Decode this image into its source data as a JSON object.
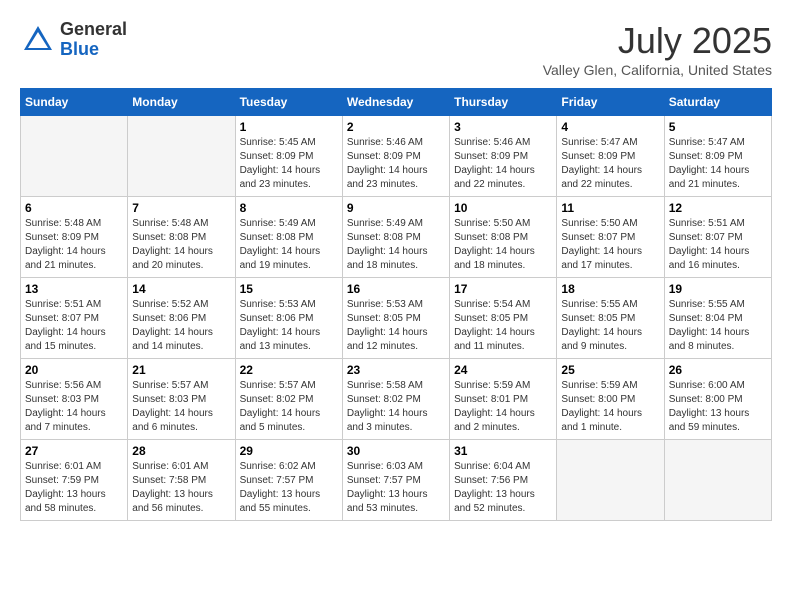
{
  "header": {
    "logo_general": "General",
    "logo_blue": "Blue",
    "month_year": "July 2025",
    "location": "Valley Glen, California, United States"
  },
  "days_of_week": [
    "Sunday",
    "Monday",
    "Tuesday",
    "Wednesday",
    "Thursday",
    "Friday",
    "Saturday"
  ],
  "weeks": [
    [
      {
        "day": "",
        "info": ""
      },
      {
        "day": "",
        "info": ""
      },
      {
        "day": "1",
        "info": "Sunrise: 5:45 AM\nSunset: 8:09 PM\nDaylight: 14 hours and 23 minutes."
      },
      {
        "day": "2",
        "info": "Sunrise: 5:46 AM\nSunset: 8:09 PM\nDaylight: 14 hours and 23 minutes."
      },
      {
        "day": "3",
        "info": "Sunrise: 5:46 AM\nSunset: 8:09 PM\nDaylight: 14 hours and 22 minutes."
      },
      {
        "day": "4",
        "info": "Sunrise: 5:47 AM\nSunset: 8:09 PM\nDaylight: 14 hours and 22 minutes."
      },
      {
        "day": "5",
        "info": "Sunrise: 5:47 AM\nSunset: 8:09 PM\nDaylight: 14 hours and 21 minutes."
      }
    ],
    [
      {
        "day": "6",
        "info": "Sunrise: 5:48 AM\nSunset: 8:09 PM\nDaylight: 14 hours and 21 minutes."
      },
      {
        "day": "7",
        "info": "Sunrise: 5:48 AM\nSunset: 8:08 PM\nDaylight: 14 hours and 20 minutes."
      },
      {
        "day": "8",
        "info": "Sunrise: 5:49 AM\nSunset: 8:08 PM\nDaylight: 14 hours and 19 minutes."
      },
      {
        "day": "9",
        "info": "Sunrise: 5:49 AM\nSunset: 8:08 PM\nDaylight: 14 hours and 18 minutes."
      },
      {
        "day": "10",
        "info": "Sunrise: 5:50 AM\nSunset: 8:08 PM\nDaylight: 14 hours and 18 minutes."
      },
      {
        "day": "11",
        "info": "Sunrise: 5:50 AM\nSunset: 8:07 PM\nDaylight: 14 hours and 17 minutes."
      },
      {
        "day": "12",
        "info": "Sunrise: 5:51 AM\nSunset: 8:07 PM\nDaylight: 14 hours and 16 minutes."
      }
    ],
    [
      {
        "day": "13",
        "info": "Sunrise: 5:51 AM\nSunset: 8:07 PM\nDaylight: 14 hours and 15 minutes."
      },
      {
        "day": "14",
        "info": "Sunrise: 5:52 AM\nSunset: 8:06 PM\nDaylight: 14 hours and 14 minutes."
      },
      {
        "day": "15",
        "info": "Sunrise: 5:53 AM\nSunset: 8:06 PM\nDaylight: 14 hours and 13 minutes."
      },
      {
        "day": "16",
        "info": "Sunrise: 5:53 AM\nSunset: 8:05 PM\nDaylight: 14 hours and 12 minutes."
      },
      {
        "day": "17",
        "info": "Sunrise: 5:54 AM\nSunset: 8:05 PM\nDaylight: 14 hours and 11 minutes."
      },
      {
        "day": "18",
        "info": "Sunrise: 5:55 AM\nSunset: 8:05 PM\nDaylight: 14 hours and 9 minutes."
      },
      {
        "day": "19",
        "info": "Sunrise: 5:55 AM\nSunset: 8:04 PM\nDaylight: 14 hours and 8 minutes."
      }
    ],
    [
      {
        "day": "20",
        "info": "Sunrise: 5:56 AM\nSunset: 8:03 PM\nDaylight: 14 hours and 7 minutes."
      },
      {
        "day": "21",
        "info": "Sunrise: 5:57 AM\nSunset: 8:03 PM\nDaylight: 14 hours and 6 minutes."
      },
      {
        "day": "22",
        "info": "Sunrise: 5:57 AM\nSunset: 8:02 PM\nDaylight: 14 hours and 5 minutes."
      },
      {
        "day": "23",
        "info": "Sunrise: 5:58 AM\nSunset: 8:02 PM\nDaylight: 14 hours and 3 minutes."
      },
      {
        "day": "24",
        "info": "Sunrise: 5:59 AM\nSunset: 8:01 PM\nDaylight: 14 hours and 2 minutes."
      },
      {
        "day": "25",
        "info": "Sunrise: 5:59 AM\nSunset: 8:00 PM\nDaylight: 14 hours and 1 minute."
      },
      {
        "day": "26",
        "info": "Sunrise: 6:00 AM\nSunset: 8:00 PM\nDaylight: 13 hours and 59 minutes."
      }
    ],
    [
      {
        "day": "27",
        "info": "Sunrise: 6:01 AM\nSunset: 7:59 PM\nDaylight: 13 hours and 58 minutes."
      },
      {
        "day": "28",
        "info": "Sunrise: 6:01 AM\nSunset: 7:58 PM\nDaylight: 13 hours and 56 minutes."
      },
      {
        "day": "29",
        "info": "Sunrise: 6:02 AM\nSunset: 7:57 PM\nDaylight: 13 hours and 55 minutes."
      },
      {
        "day": "30",
        "info": "Sunrise: 6:03 AM\nSunset: 7:57 PM\nDaylight: 13 hours and 53 minutes."
      },
      {
        "day": "31",
        "info": "Sunrise: 6:04 AM\nSunset: 7:56 PM\nDaylight: 13 hours and 52 minutes."
      },
      {
        "day": "",
        "info": ""
      },
      {
        "day": "",
        "info": ""
      }
    ]
  ]
}
